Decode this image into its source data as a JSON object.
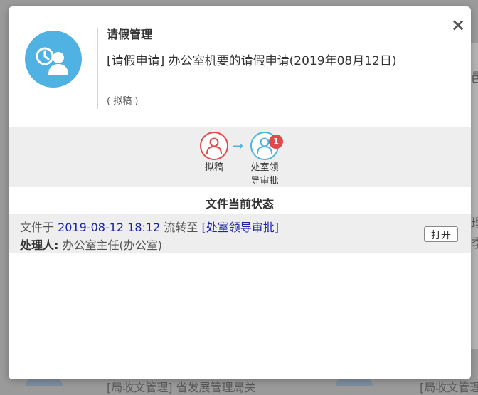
{
  "dialog": {
    "doc_type": "请假管理",
    "doc_title": "[请假申请]  办公室机要的请假申请(2019年08月12日)",
    "doc_status": "( 拟稿 )",
    "close_label": "×"
  },
  "flow": {
    "steps": [
      {
        "label": "拟稿",
        "state": "done"
      },
      {
        "label_line1": "处室领",
        "label_line2": "导审批",
        "state": "current",
        "badge": "1"
      }
    ],
    "arrow": "→"
  },
  "status": {
    "section_title": "文件当前状态",
    "prefix": "文件于 ",
    "datetime": "2019-08-12 18:12",
    "mid": " 流转至 ",
    "target": "[处室领导审批]",
    "handler_label": "处理人:",
    "handler_value": " 办公室主任(办公室)",
    "open_button": "打开"
  },
  "background": {
    "right_fragments": [
      "邑",
      "理",
      "季"
    ],
    "bottom_fragments": [
      "[局收文管理]  省发展管理局关",
      "[局收文管理"
    ]
  },
  "colors": {
    "accent_blue": "#4fb2e3",
    "accent_red": "#e14a4a",
    "link_blue": "#1a22a8"
  }
}
